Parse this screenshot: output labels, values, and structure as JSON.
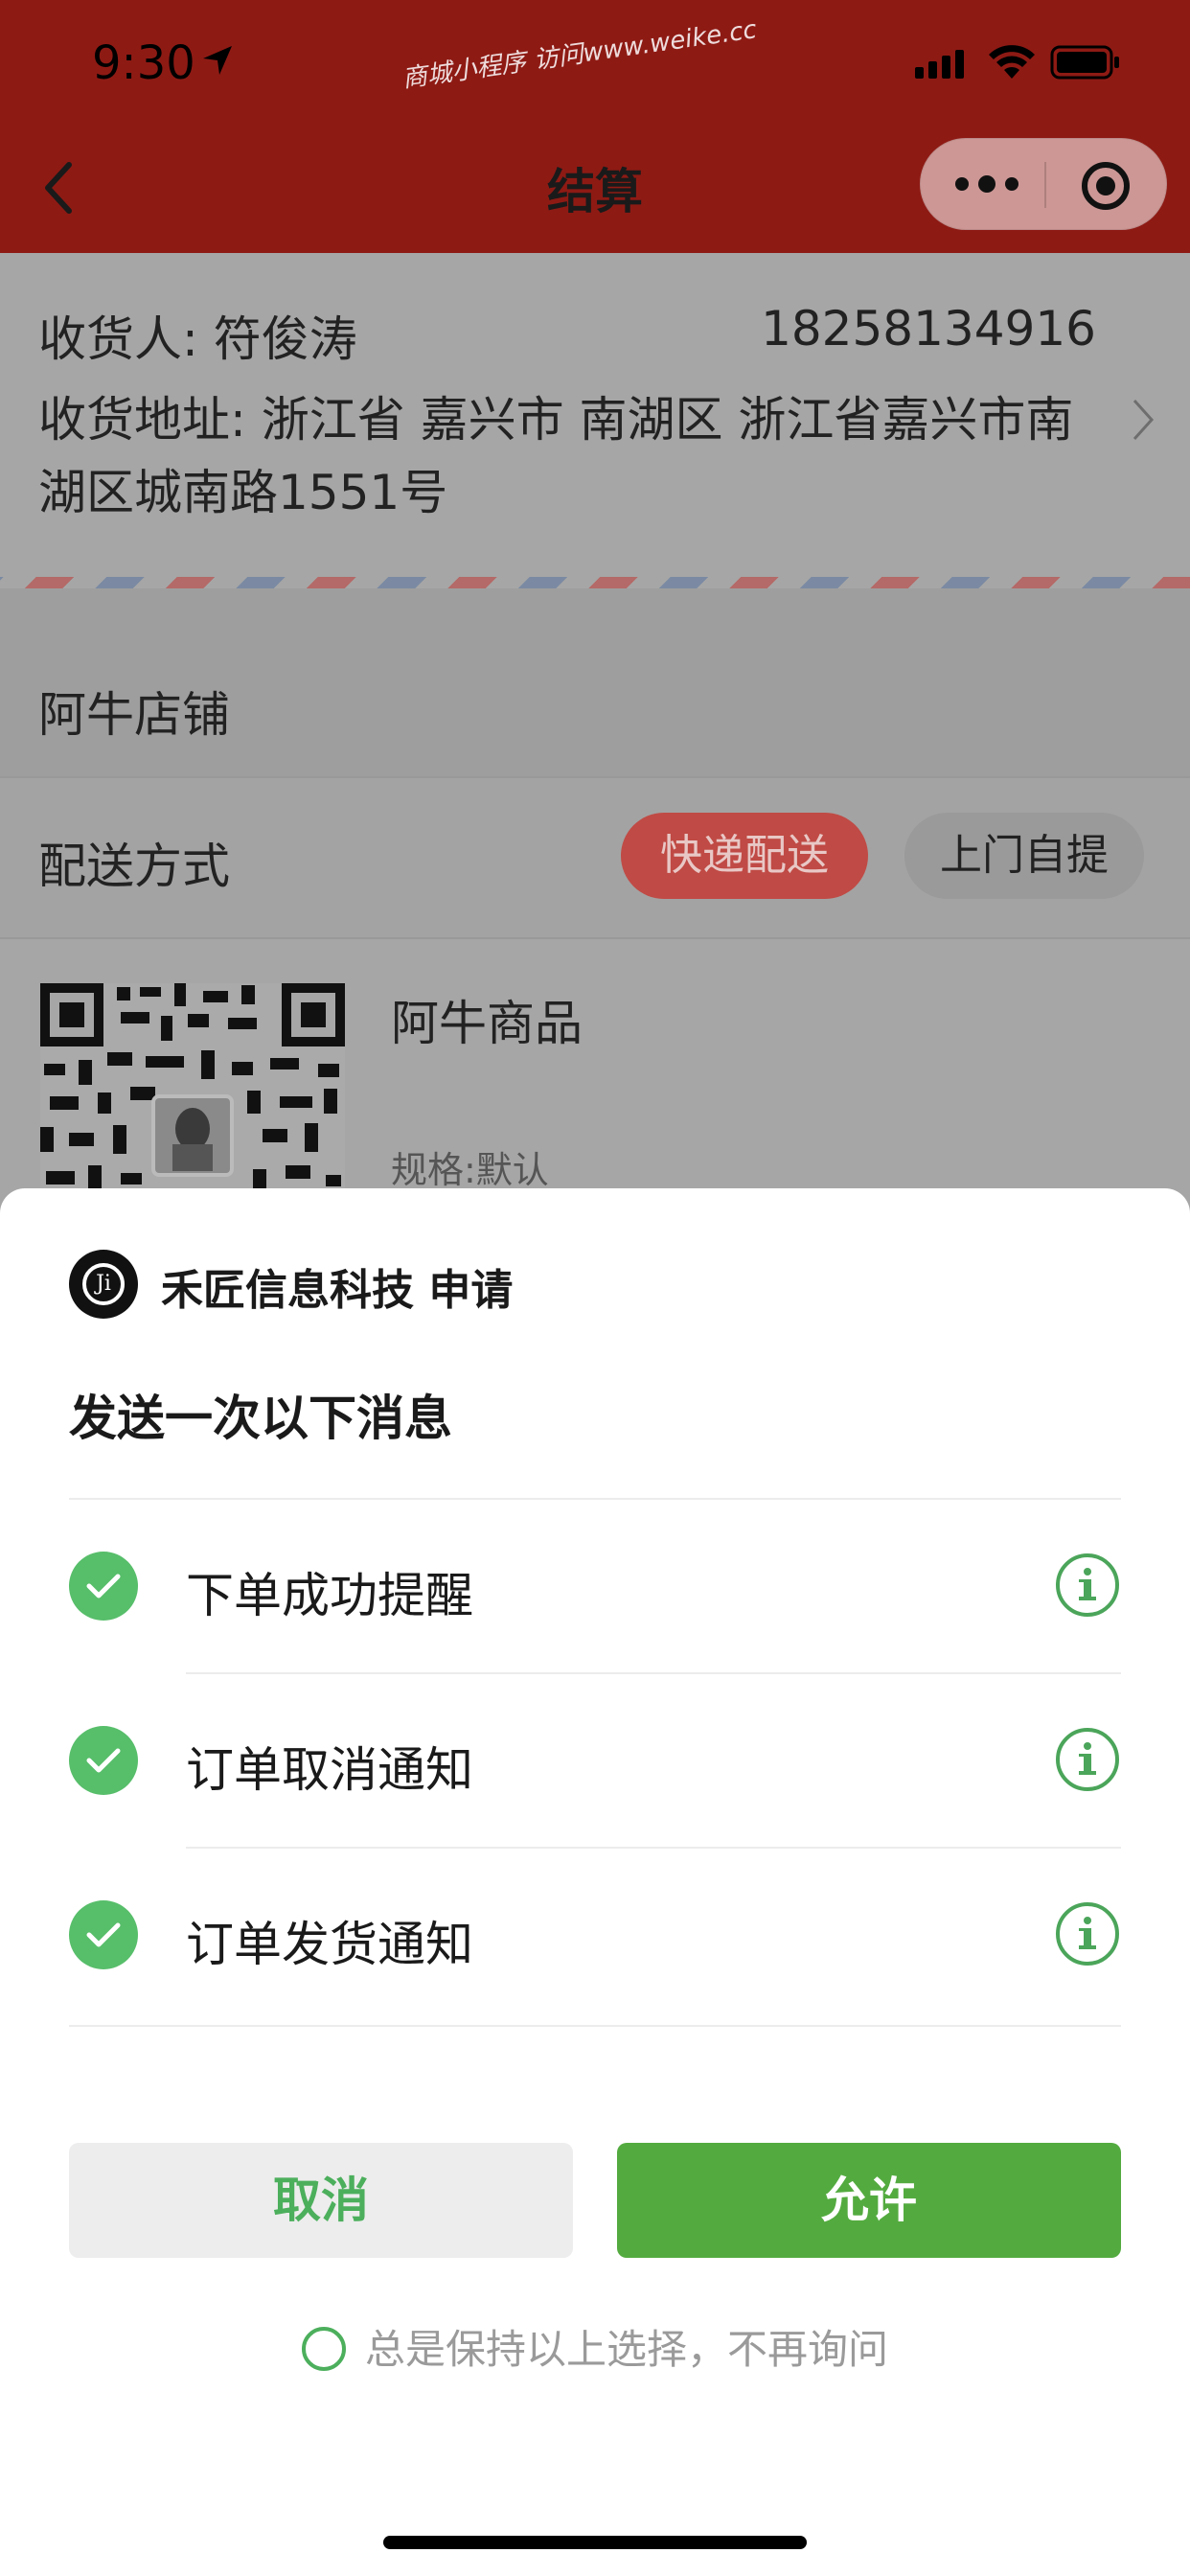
{
  "status_bar": {
    "time": "9:30"
  },
  "watermark": "商城小程序 访问www.weike.cc",
  "nav": {
    "title": "结算"
  },
  "address": {
    "receiver": "收货人: 符俊涛",
    "phone": "18258134916",
    "address_text": "收货地址: 浙江省 嘉兴市 南湖区 浙江省嘉兴市南湖区城南路1551号"
  },
  "store": {
    "name": "阿牛店铺"
  },
  "delivery": {
    "label": "配送方式",
    "options": [
      "快递配送",
      "上门自提"
    ],
    "selected": "快递配送"
  },
  "product": {
    "name": "阿牛商品",
    "spec": "规格:默认"
  },
  "sheet": {
    "app_request": "禾匠信息科技 申请",
    "heading": "发送一次以下消息",
    "messages": [
      {
        "label": "下单成功提醒",
        "checked": true
      },
      {
        "label": "订单取消通知",
        "checked": true
      },
      {
        "label": "订单发货通知",
        "checked": true
      }
    ],
    "cancel_label": "取消",
    "allow_label": "允许",
    "always_label": "总是保持以上选择，不再询问"
  },
  "colors": {
    "header_bg": "#8e1a14",
    "accent_green": "#53ab3f",
    "check_green": "#57be6a",
    "express_red": "#c04a45"
  }
}
